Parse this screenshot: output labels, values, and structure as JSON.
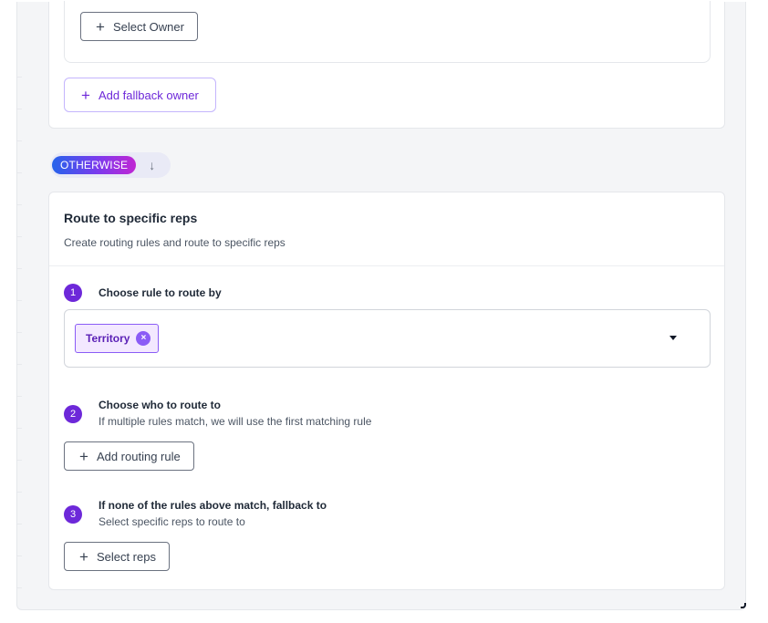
{
  "top_card": {
    "select_owner_label": "Select Owner",
    "add_fallback_owner_label": "Add fallback owner"
  },
  "otherwise": {
    "label": "OTHERWISE",
    "arrow": "↓"
  },
  "route_card": {
    "title": "Route to specific reps",
    "subtitle": "Create routing rules and route to specific reps",
    "steps": [
      {
        "number": "1",
        "title": "Choose rule to route by"
      },
      {
        "number": "2",
        "title": "Choose who to route to",
        "description": "If multiple rules match, we will use the first matching rule"
      },
      {
        "number": "3",
        "title": "If none of the rules above match, fallback to",
        "description": "Select specific reps to route to"
      }
    ],
    "rule_select": {
      "selected_chip": "Territory",
      "remove_icon": "×"
    },
    "add_routing_rule_label": "Add routing rule",
    "select_reps_label": "Select reps"
  },
  "icons": {
    "plus": "+"
  },
  "colors": {
    "accent": "#6d28d9",
    "chip_bg": "#f3e8ff",
    "chip_border": "#8b5cf6",
    "panel_bg": "#f4f5f7"
  }
}
